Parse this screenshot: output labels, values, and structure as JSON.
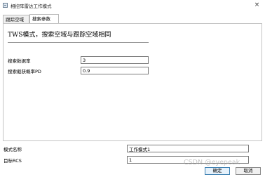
{
  "window": {
    "title": "相控阵雷达工作模式",
    "close_glyph": "×"
  },
  "tabs": [
    {
      "label": "跟踪空域",
      "active": false
    },
    {
      "label": "搜索参数",
      "active": true
    }
  ],
  "panel": {
    "heading": "TWS模式，搜索空域与跟踪空域相同",
    "fields": [
      {
        "label": "搜索数据率",
        "value": "3"
      },
      {
        "label": "搜索截获概率PD",
        "value": "0.9"
      }
    ]
  },
  "bottom": {
    "mode_name_label": "模式名称",
    "mode_name_value": "工作模式1",
    "target_rcs_label": "目标RCS",
    "target_rcs_value": "1",
    "ok_label": "确定",
    "cancel_label": "取消"
  },
  "watermark": "CSDN @eyepeak"
}
